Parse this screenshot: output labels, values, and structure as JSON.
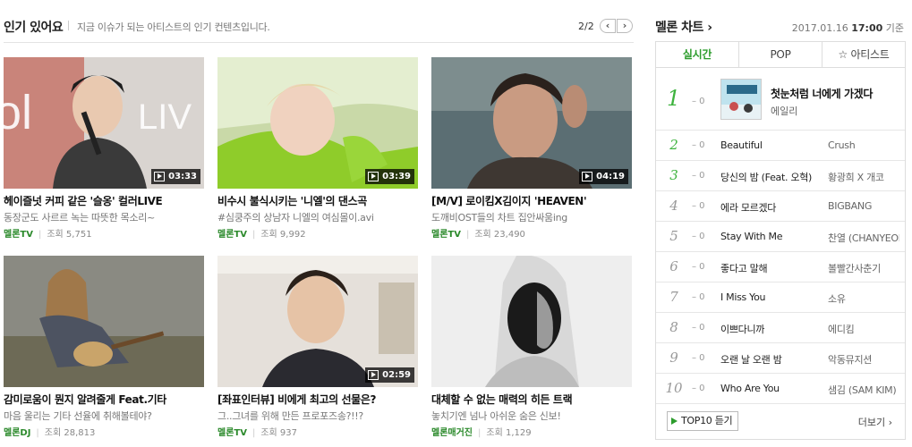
{
  "popular": {
    "title": "인기 있어요",
    "description": "지금 이슈가 되는 아티스트의 인기 컨텐츠입니다.",
    "page": "2/2",
    "prev_icon": "‹",
    "next_icon": "›",
    "cards": [
      {
        "title": "헤이즐넛 커피 같은 '슬옹' 컬러LIVE",
        "subtitle": "동장군도 사르르 녹는 따뜻한 목소리~",
        "source": "멜론TV",
        "views": "조회 5,751",
        "duration": "03:33"
      },
      {
        "title": "비수시 불식시키는 '니엘'의 댄스곡",
        "subtitle": "#심쿵주의 상남자 니엘의 여심몰이.avi",
        "source": "멜론TV",
        "views": "조회 9,992",
        "duration": "03:39"
      },
      {
        "title": "[M/V] 로이킴X김이지 'HEAVEN'",
        "subtitle": "도깨비OST들의 차트 집안싸움ing",
        "source": "멜론TV",
        "views": "조회 23,490",
        "duration": "04:19"
      },
      {
        "title": "감미로움이 뭔지 알려줄게 Feat.기타",
        "subtitle": "마음 울리는 기타 선율에 취해볼테야?",
        "source": "멜론DJ",
        "views": "조회 28,813",
        "duration": ""
      },
      {
        "title": "[좌표인터뷰] 비에게 최고의 선물은?",
        "subtitle": "그..그녀를 위해 만든 프로포즈송?!!?",
        "source": "멜론TV",
        "views": "조회 937",
        "duration": "02:59"
      },
      {
        "title": "대체할 수 없는 매력의 히든 트랙",
        "subtitle": "놓치기엔 넘나 아쉬운 숨은 신보!",
        "source": "멜론매거진",
        "views": "조회 1,129",
        "duration": ""
      }
    ]
  },
  "chart": {
    "title": "멜론 차트",
    "arrow": "›",
    "date": "2017.01.16",
    "time": "17:00",
    "time_suffix": "기준",
    "tabs": [
      "실시간",
      "POP",
      "☆ 아티스트"
    ],
    "active_tab": "실시간",
    "entries": [
      {
        "rank": "1",
        "change": "– 0",
        "song": "첫눈처럼 너에게 가겠다",
        "singer": "에일리"
      },
      {
        "rank": "2",
        "change": "– 0",
        "song": "Beautiful",
        "singer": "Crush"
      },
      {
        "rank": "3",
        "change": "– 0",
        "song": "당신의 밤 (Feat. 오혁)",
        "singer": "황광희 X 개코"
      },
      {
        "rank": "4",
        "change": "– 0",
        "song": "에라 모르겠다",
        "singer": "BIGBANG"
      },
      {
        "rank": "5",
        "change": "– 0",
        "song": "Stay With Me",
        "singer": "찬열 (CHANYEOL)"
      },
      {
        "rank": "6",
        "change": "– 0",
        "song": "좋다고 말해",
        "singer": "볼빨간사춘기"
      },
      {
        "rank": "7",
        "change": "– 0",
        "song": "I Miss You",
        "singer": "소유"
      },
      {
        "rank": "8",
        "change": "– 0",
        "song": "이쁘다니까",
        "singer": "에디킴"
      },
      {
        "rank": "9",
        "change": "– 0",
        "song": "오랜 날 오랜 밤",
        "singer": "악동뮤지션"
      },
      {
        "rank": "10",
        "change": "– 0",
        "song": "Who Are You",
        "singer": "샘김 (SAM KIM)"
      }
    ],
    "top10_button": "TOP10 듣기",
    "more_link": "더보기 ›"
  },
  "colors": {
    "accent": "#3eb33e",
    "source_green": "#2c8a2c"
  }
}
